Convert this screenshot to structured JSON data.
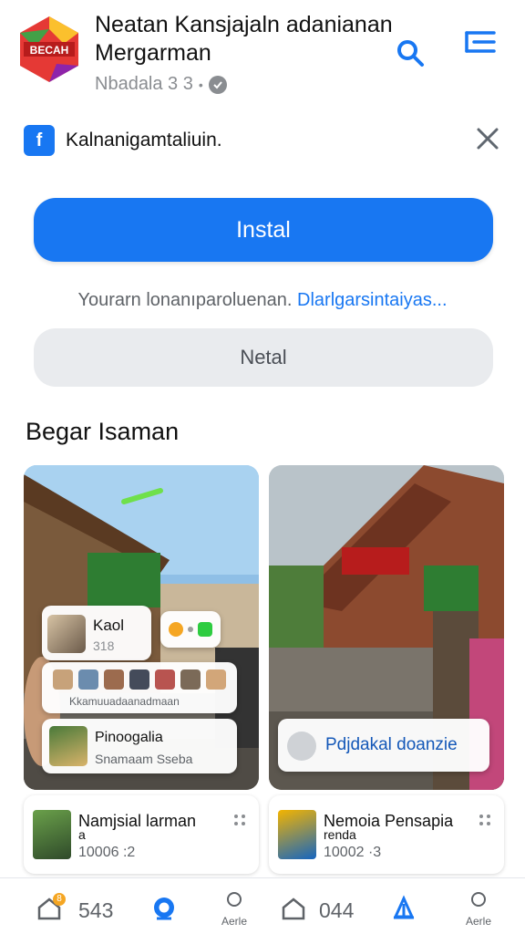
{
  "header": {
    "title": "Neatan Kansjajaln adanianan Mergarman",
    "meta_text": "Nbadala 3 3",
    "meta_dot": "•",
    "logo_text": "BECAH"
  },
  "banner": {
    "text": "Kalnanigamtaliuin."
  },
  "actions": {
    "install_label": "Instal",
    "helper_text": "Yourarn lonanıparoluenan.",
    "helper_link": "Dlarlgarsintaiyas...",
    "secondary_label": "Netal"
  },
  "section": {
    "title": "Begar Isaman"
  },
  "cards": {
    "left": {
      "kaol_name": "Kaol",
      "kaol_number": "318",
      "faces_text": "Kkamuuadaanadmaan",
      "pino_title": "Pinoogalia",
      "pino_subtitle": "Snamaam Sseba"
    },
    "right": {
      "overlay_text": "Pdjdakal doanzie"
    }
  },
  "posts": [
    {
      "name": "Namjsial larman",
      "sub": "a",
      "count": "10006 :2"
    },
    {
      "name": "Nemoia Pensapia",
      "sub": "renda",
      "count": "10002 ·3"
    }
  ],
  "navbar": {
    "home_count": "543",
    "notif_badge": "8",
    "profile_label": "Aerle",
    "market_count": "044",
    "menu_label": "Aerle"
  },
  "colors": {
    "accent": "#1877f2",
    "secondary_bg": "#e9ebee",
    "text_muted": "#8a8d91"
  }
}
